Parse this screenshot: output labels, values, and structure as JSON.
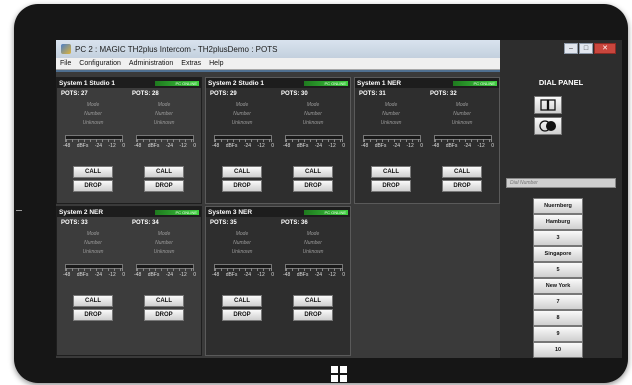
{
  "app": {
    "title": "PC 2 : MAGIC TH2plus Intercom - TH2plusDemo : POTS",
    "menu": [
      "File",
      "Configuration",
      "Administration",
      "Extras",
      "Help"
    ]
  },
  "panels": [
    {
      "title": "System 1 Studio 1",
      "status": "PC ONLINE",
      "active": false,
      "lines": [
        {
          "pots": "POTS: 27",
          "mode": "Mode",
          "number": "Number",
          "state": "Unknown",
          "call": "CALL",
          "drop": "DROP"
        },
        {
          "pots": "POTS: 28",
          "mode": "Mode",
          "number": "Number",
          "state": "Unknown",
          "call": "CALL",
          "drop": "DROP"
        }
      ]
    },
    {
      "title": "System 2 Studio 1",
      "status": "PC ONLINE",
      "active": true,
      "lines": [
        {
          "pots": "POTS: 29",
          "mode": "Mode",
          "number": "Number",
          "state": "Unknown",
          "call": "CALL",
          "drop": "DROP"
        },
        {
          "pots": "POTS: 30",
          "mode": "Mode",
          "number": "Number",
          "state": "Unknown",
          "call": "CALL",
          "drop": "DROP"
        }
      ]
    },
    {
      "title": "System 1 NER",
      "status": "PC ONLINE",
      "active": true,
      "lines": [
        {
          "pots": "POTS: 31",
          "mode": "Mode",
          "number": "Number",
          "state": "Unknown",
          "call": "CALL",
          "drop": "DROP"
        },
        {
          "pots": "POTS: 32",
          "mode": "Mode",
          "number": "Number",
          "state": "Unknown",
          "call": "CALL",
          "drop": "DROP"
        }
      ]
    },
    {
      "title": "System 2 NER",
      "status": "PC ONLINE",
      "active": false,
      "lines": [
        {
          "pots": "POTS: 33",
          "mode": "Mode",
          "number": "Number",
          "state": "Unknown",
          "call": "CALL",
          "drop": "DROP"
        },
        {
          "pots": "POTS: 34",
          "mode": "Mode",
          "number": "Number",
          "state": "Unknown",
          "call": "CALL",
          "drop": "DROP"
        }
      ]
    },
    {
      "title": "System 3 NER",
      "status": "PC ONLINE",
      "active": true,
      "lines": [
        {
          "pots": "POTS: 35",
          "mode": "Mode",
          "number": "Number",
          "state": "Unknown",
          "call": "CALL",
          "drop": "DROP"
        },
        {
          "pots": "POTS: 36",
          "mode": "Mode",
          "number": "Number",
          "state": "Unknown",
          "call": "CALL",
          "drop": "DROP"
        }
      ]
    }
  ],
  "meter": {
    "scale": [
      "-48",
      "dBFs",
      "-24",
      "-12",
      "0"
    ]
  },
  "dial_panel": {
    "title": "DIAL PANEL",
    "phonebook_icon": "book-icon",
    "record_icon": "toggle-icon",
    "input_placeholder": "Dial Number",
    "speed_dials": [
      "Nuernberg",
      "Hamburg",
      "3",
      "Singapore",
      "5",
      "New York",
      "7",
      "8",
      "9",
      "10"
    ]
  },
  "window_controls": {
    "minimize": "–",
    "maximize": "□",
    "close": "✕"
  },
  "colors": {
    "online": "#3fcf3f",
    "panel_bg": "#3c3c3c",
    "active_panel_bg": "#2e2e2e",
    "button": "#e6e6e6"
  }
}
